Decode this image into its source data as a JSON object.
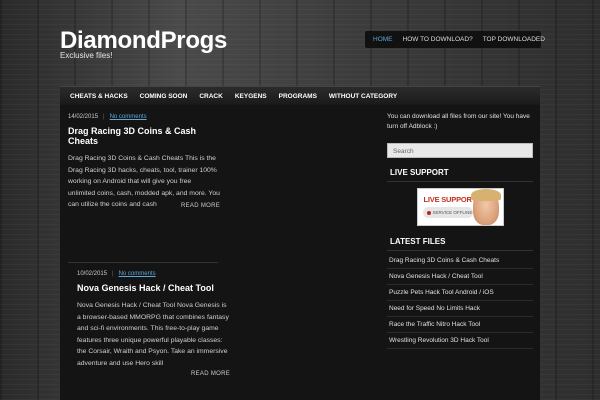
{
  "header": {
    "site_title": "DiamondProgs",
    "tagline": "Exclusive files!"
  },
  "top_nav": [
    {
      "label": "HOME",
      "active": true
    },
    {
      "label": "HOW TO DOWNLOAD?",
      "active": false
    },
    {
      "label": "TOP DOWNLOADED",
      "active": false
    }
  ],
  "main_nav": [
    "CHEATS & HACKS",
    "COMING SOON",
    "CRACK",
    "KEYGENS",
    "PROGRAMS",
    "WITHOUT CATEGORY"
  ],
  "posts": [
    {
      "date": "14/02/2015",
      "separator": "|",
      "comments": "No comments",
      "title": "Drag Racing 3D Coins & Cash Cheats",
      "excerpt": "Drag Racing 3D Coins & Cash Cheats This is the Drag Racing 3D hacks, cheats, tool, trainer 100% working on Android that will give you free unlimited coins, cash, modded apk, and more. You can utilize the coins and cash",
      "read_more": "READ MORE"
    },
    {
      "date": "10/02/2015",
      "separator": "|",
      "comments": "No comments",
      "title": "Nova Genesis Hack / Cheat Tool",
      "excerpt": "Nova Genesis Hack / Cheat Tool Nova Genesis is a browser-based MMORPG that combines fantasy and sci-fi environments. This free-to-play game features three unique powerful playable classes: the Corsair, Wraith and Psyon. Take an immersive adventure and use Hero skill",
      "read_more": "READ MORE"
    }
  ],
  "sidebar": {
    "notice": "You can download all files from our site! You have turn off Adblock :)",
    "search_placeholder": "Search",
    "live_support_title": "LIVE SUPPORT",
    "live_support_badge": {
      "title": "LIVE SUPPORT",
      "status": "SERVICE OFFLINE"
    },
    "latest_files_title": "LATEST FILES",
    "latest_files": [
      "Drag Racing 3D Coins & Cash Cheats",
      "Nova Genesis Hack / Cheat Tool",
      "Puzzle Pets Hack Tool Android / iOS",
      "Need for Speed No Limits Hack",
      "Race the Traffic Nitro Hack Tool",
      "Wrestling Revolution 3D Hack Tool"
    ]
  },
  "colors": {
    "accent": "#5fa8d8",
    "content_bg": "#141414",
    "nav_bg": "#111111"
  }
}
